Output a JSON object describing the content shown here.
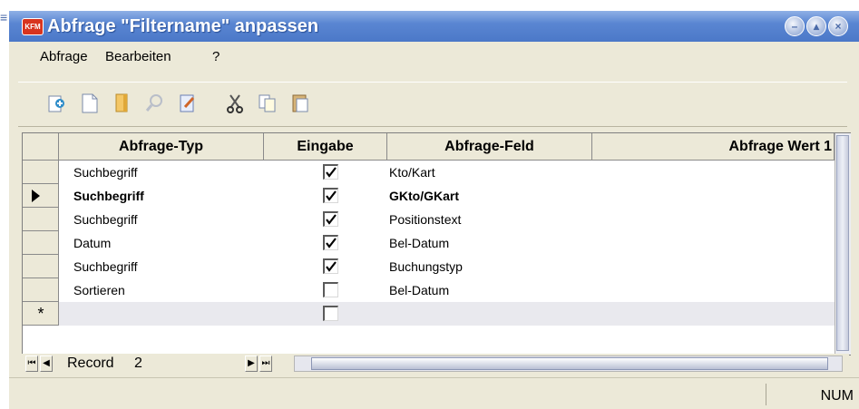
{
  "window": {
    "title": "Abfrage \"Filtername\" anpassen"
  },
  "menu": {
    "items": [
      "Abfrage",
      "Bearbeiten",
      "?"
    ]
  },
  "toolbar": {
    "icons": [
      "open-icon",
      "new-document-icon",
      "bookmark-icon",
      "search-icon",
      "edit-document-icon",
      "cut-icon",
      "copy-icon",
      "paste-icon"
    ]
  },
  "grid": {
    "columns": [
      "Abfrage-Typ",
      "Eingabe",
      "Abfrage-Feld",
      "Abfrage Wert 1"
    ],
    "rows": [
      {
        "typ": "Suchbegriff",
        "eingabe": true,
        "feld": "Kto/Kart",
        "current": false
      },
      {
        "typ": "Suchbegriff",
        "eingabe": true,
        "feld": "GKto/GKart",
        "current": true
      },
      {
        "typ": "Suchbegriff",
        "eingabe": true,
        "feld": "Positionstext",
        "current": false
      },
      {
        "typ": "Datum",
        "eingabe": true,
        "feld": "Bel-Datum",
        "current": false
      },
      {
        "typ": "Suchbegriff",
        "eingabe": true,
        "feld": "Buchungstyp",
        "current": false
      },
      {
        "typ": "Sortieren",
        "eingabe": false,
        "feld": "Bel-Datum",
        "current": false
      }
    ],
    "new_row_marker": "*"
  },
  "navigator": {
    "label": "Record",
    "current": "2"
  },
  "status": {
    "num": "NUM"
  },
  "colors": {
    "titlebar": "#4b78c8",
    "face": "#ece9d8"
  }
}
